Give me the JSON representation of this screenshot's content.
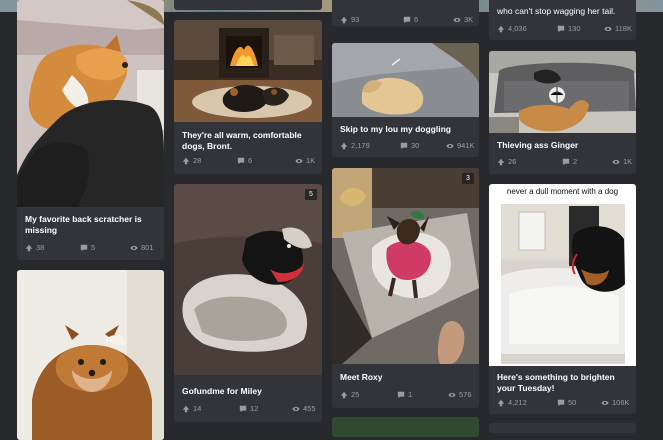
{
  "posts": [
    {
      "title": "My favorite back scratcher is missing",
      "upvotes": "38",
      "comments": "5",
      "views": "801"
    },
    {
      "title": "They're all warm, comfortable dogs, Bront.",
      "upvotes": "28",
      "comments": "6",
      "views": "1K"
    },
    {
      "title": "Skip to my lou my doggling",
      "upvotes": "2,179",
      "comments": "30",
      "views": "941K"
    },
    {
      "title": "Thieving ass Ginger",
      "upvotes": "26",
      "comments": "2",
      "views": "1K"
    },
    {
      "title": "Gofundme for Miley",
      "upvotes": "14",
      "comments": "12",
      "views": "455",
      "badge": "5"
    },
    {
      "title": "Meet Roxy",
      "upvotes": "25",
      "comments": "1",
      "views": "576",
      "badge": "3"
    },
    {
      "title": "Here's something to brighten your Tuesday!",
      "upvotes": "4,212",
      "comments": "50",
      "views": "106K",
      "caption": "never a dull moment with a dog"
    },
    {
      "top_stats": {
        "upvotes": "93",
        "comments": "6",
        "views": "3K"
      }
    },
    {
      "top_title": "who can't stop wagging her tail.",
      "upvotes": "4,036",
      "comments": "130",
      "views": "118K"
    }
  ]
}
